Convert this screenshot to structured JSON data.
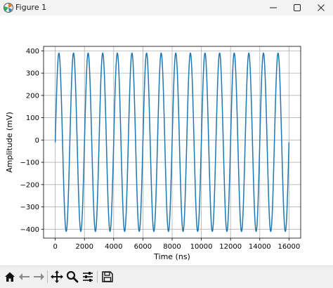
{
  "window": {
    "title": "Figure 1",
    "controls": [
      "minimize",
      "maximize",
      "close"
    ]
  },
  "toolbar": {
    "buttons": [
      {
        "name": "home",
        "icon": "home-icon"
      },
      {
        "name": "back",
        "icon": "arrow-left-icon"
      },
      {
        "name": "forward",
        "icon": "arrow-right-icon"
      },
      {
        "name": "pan",
        "icon": "move-icon"
      },
      {
        "name": "zoom",
        "icon": "magnifier-icon"
      },
      {
        "name": "configure-subplots",
        "icon": "sliders-icon"
      },
      {
        "name": "save",
        "icon": "floppy-disk-icon"
      }
    ]
  },
  "chart_data": {
    "type": "line",
    "title": "",
    "xlabel": "Time (ns)",
    "ylabel": "Amplitude (mV)",
    "xlim": [
      -800,
      16800
    ],
    "ylim": [
      -440,
      420
    ],
    "xticks": [
      0,
      2000,
      4000,
      6000,
      8000,
      10000,
      12000,
      14000,
      16000
    ],
    "yticks": [
      -400,
      -300,
      -200,
      -100,
      0,
      100,
      200,
      300,
      400
    ],
    "grid": true,
    "legend": "none",
    "series": [
      {
        "color": "#1f77b4",
        "function": "sine",
        "x_start": 0,
        "x_end": 16000,
        "amplitude_max": 390,
        "amplitude_min": -410,
        "offset": -10,
        "cycles": 16,
        "start_value": 0,
        "end_value": -10
      }
    ]
  }
}
